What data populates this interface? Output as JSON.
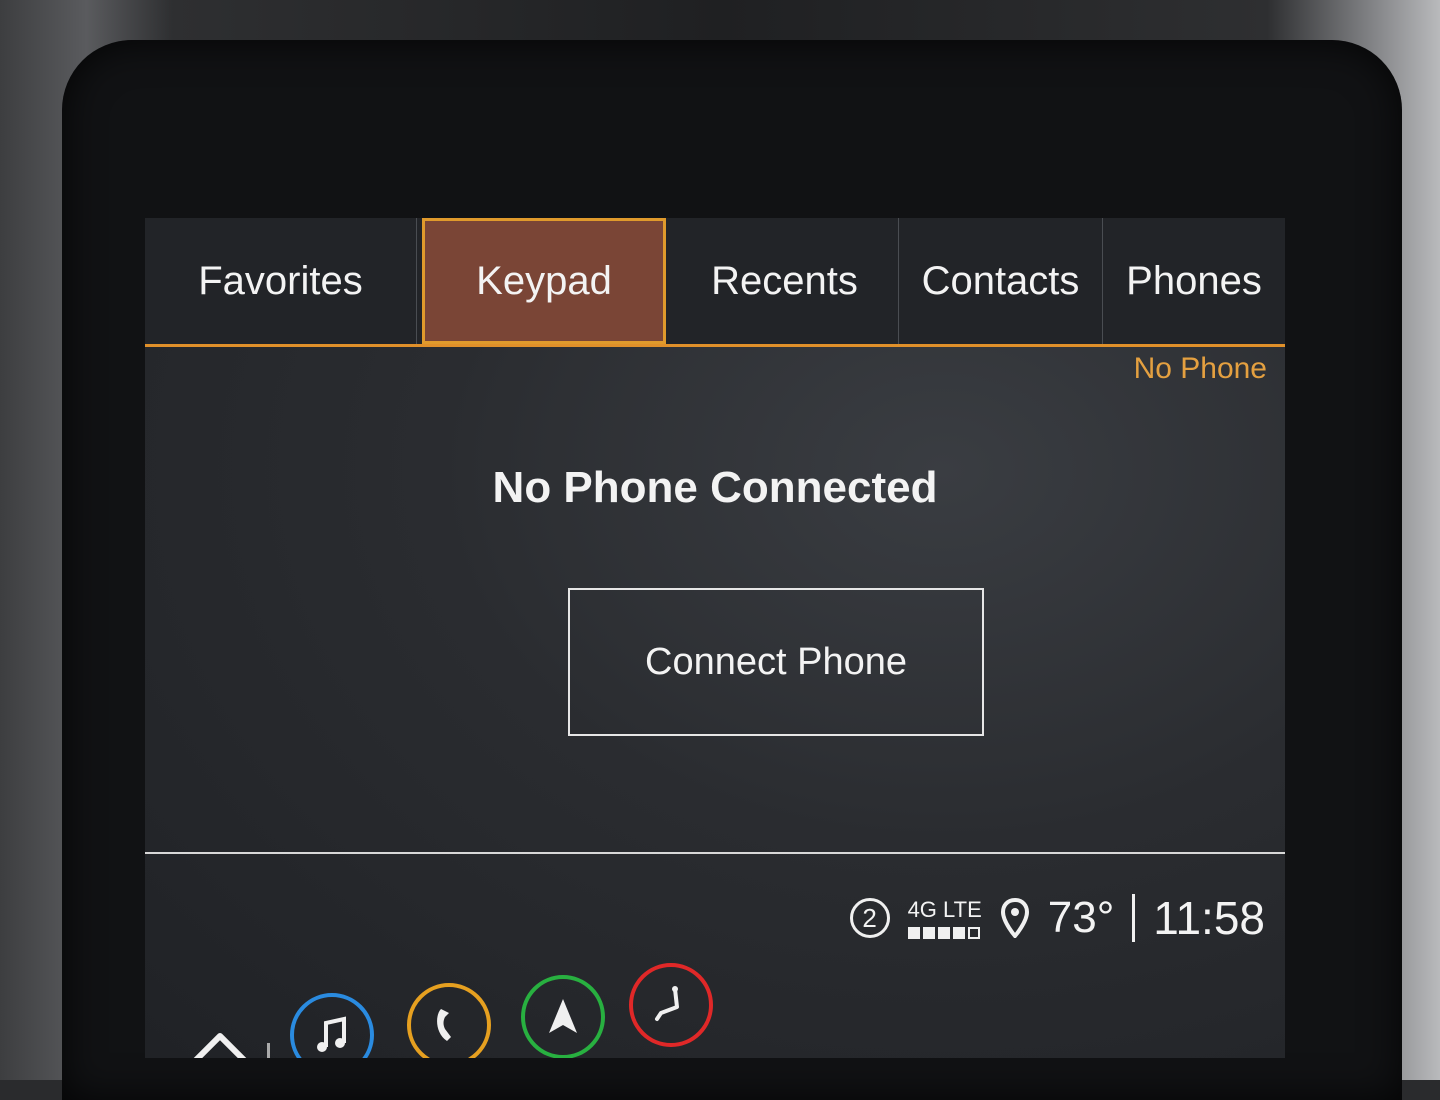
{
  "tabs": [
    {
      "label": "Favorites",
      "active": false
    },
    {
      "label": "Keypad",
      "active": true
    },
    {
      "label": "Recents",
      "active": false
    },
    {
      "label": "Contacts",
      "active": false
    },
    {
      "label": "Phones",
      "active": false
    }
  ],
  "phone_status": "No Phone",
  "message": "No Phone Connected",
  "connect_button": "Connect Phone",
  "status_bar": {
    "notification_count": "2",
    "network": "4G LTE",
    "signal_strength": 4,
    "signal_max": 5,
    "temperature": "73°",
    "time": "11:58"
  },
  "dock": [
    {
      "name": "home",
      "color": "#f0f0f0"
    },
    {
      "name": "audio",
      "color": "#2a8be0"
    },
    {
      "name": "phone",
      "color": "#e6a020"
    },
    {
      "name": "navigation",
      "color": "#28b040"
    },
    {
      "name": "seat-settings",
      "color": "#e02828"
    }
  ],
  "colors": {
    "accent": "#e0902a",
    "active_tab_bg": "#7a4536",
    "phone_status": "#e4a040"
  }
}
